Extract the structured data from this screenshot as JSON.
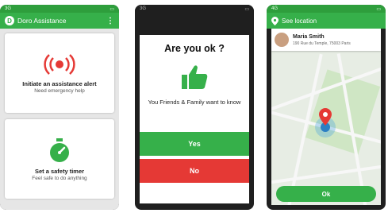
{
  "phone1": {
    "status_left": "3G",
    "app_title": "Doro Assistance",
    "menu_icon": "more-vert-icon",
    "cards": [
      {
        "title": "Initiate an assistance alert",
        "subtitle": "Need emergency help",
        "icon": "alarm-icon"
      },
      {
        "title": "Set a safety timer",
        "subtitle": "Feel safe to do anything",
        "icon": "stopwatch-icon"
      }
    ]
  },
  "phone2": {
    "status_left": "3G",
    "title": "Are you ok ?",
    "message": "You Friends & Family want to know",
    "icon": "thumbs-up-icon",
    "yes_label": "Yes",
    "no_label": "No"
  },
  "phone3": {
    "status_left": "4G",
    "title": "See location",
    "contact_name": "Maria Smith",
    "contact_address": "190 Rue du Temple, 75003 Paris",
    "ok_label": "Ok"
  },
  "colors": {
    "green": "#36b04a",
    "red": "#e53935"
  }
}
